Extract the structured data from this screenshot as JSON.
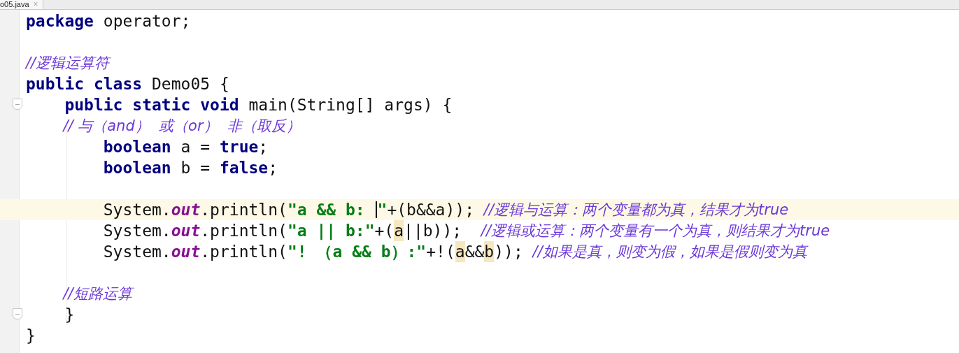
{
  "tab": {
    "label": "o05.java",
    "close": "×",
    "selected": true
  },
  "lines": [
    {
      "current": false,
      "fold": false,
      "tokens": [
        {
          "kind": "kw",
          "text": "package"
        },
        {
          "kind": "plain",
          "text": " operator;"
        }
      ]
    },
    {
      "blank_before": true,
      "current": false,
      "fold": false,
      "tokens": [
        {
          "kind": "comment",
          "text": "//逻辑运算符"
        }
      ]
    },
    {
      "current": false,
      "fold": false,
      "tokens": [
        {
          "kind": "kw",
          "text": "public class"
        },
        {
          "kind": "plain",
          "text": " Demo05 {"
        }
      ]
    },
    {
      "current": false,
      "fold": true,
      "tokens": [
        {
          "kind": "kw",
          "text": "    public static void"
        },
        {
          "kind": "plain",
          "text": " main(String[] args) {"
        }
      ]
    },
    {
      "current": false,
      "fold": false,
      "tokens": [
        {
          "kind": "comment",
          "text": "        // 与（and）  或（or）  非（取反）"
        }
      ]
    },
    {
      "current": false,
      "fold": false,
      "tokens": [
        {
          "kind": "kw",
          "text": "        boolean"
        },
        {
          "kind": "plain",
          "text": " a = "
        },
        {
          "kind": "kw",
          "text": "true"
        },
        {
          "kind": "plain",
          "text": ";"
        }
      ]
    },
    {
      "current": false,
      "fold": false,
      "tokens": [
        {
          "kind": "kw",
          "text": "        boolean"
        },
        {
          "kind": "plain",
          "text": " b = "
        },
        {
          "kind": "kw",
          "text": "false"
        },
        {
          "kind": "plain",
          "text": ";"
        }
      ]
    },
    {
      "blank_before": true,
      "current": true,
      "fold": false,
      "tokens": [
        {
          "kind": "plain",
          "text": "        System."
        },
        {
          "kind": "field",
          "text": "out"
        },
        {
          "kind": "plain",
          "text": ".println("
        },
        {
          "kind": "string",
          "text": "\"a && b: "
        },
        {
          "kind": "caret"
        },
        {
          "kind": "string",
          "text": "\""
        },
        {
          "kind": "plain",
          "text": "+(b&&a)); "
        },
        {
          "kind": "comment",
          "text": "//逻辑与运算：两个变量都为真，结果才为true"
        }
      ]
    },
    {
      "current": false,
      "fold": false,
      "tokens": [
        {
          "kind": "plain",
          "text": "        System."
        },
        {
          "kind": "field",
          "text": "out"
        },
        {
          "kind": "plain",
          "text": ".println("
        },
        {
          "kind": "string",
          "text": "\"a || b:\""
        },
        {
          "kind": "plain",
          "text": "+("
        },
        {
          "kind": "match",
          "text": "a"
        },
        {
          "kind": "plain",
          "text": "||b));  "
        },
        {
          "kind": "comment",
          "text": "//逻辑或运算：两个变量有一个为真，则结果才为true"
        }
      ]
    },
    {
      "current": false,
      "fold": false,
      "tokens": [
        {
          "kind": "plain",
          "text": "        System."
        },
        {
          "kind": "field",
          "text": "out"
        },
        {
          "kind": "plain",
          "text": ".println("
        },
        {
          "kind": "string",
          "text": "\"! （a && b）:\""
        },
        {
          "kind": "plain",
          "text": "+!("
        },
        {
          "kind": "match",
          "text": "a"
        },
        {
          "kind": "plain",
          "text": "&&"
        },
        {
          "kind": "match",
          "text": "b"
        },
        {
          "kind": "plain",
          "text": ")); "
        },
        {
          "kind": "comment",
          "text": "//如果是真，则变为假，如果是假则变为真"
        }
      ]
    },
    {
      "blank_before": true,
      "current": false,
      "fold": false,
      "tokens": [
        {
          "kind": "comment",
          "text": "        //短路运算"
        }
      ]
    },
    {
      "current": false,
      "fold": true,
      "tokens": [
        {
          "kind": "plain",
          "text": "    }"
        }
      ]
    },
    {
      "current": false,
      "fold": false,
      "tokens": [
        {
          "kind": "plain",
          "text": "}"
        }
      ]
    }
  ]
}
